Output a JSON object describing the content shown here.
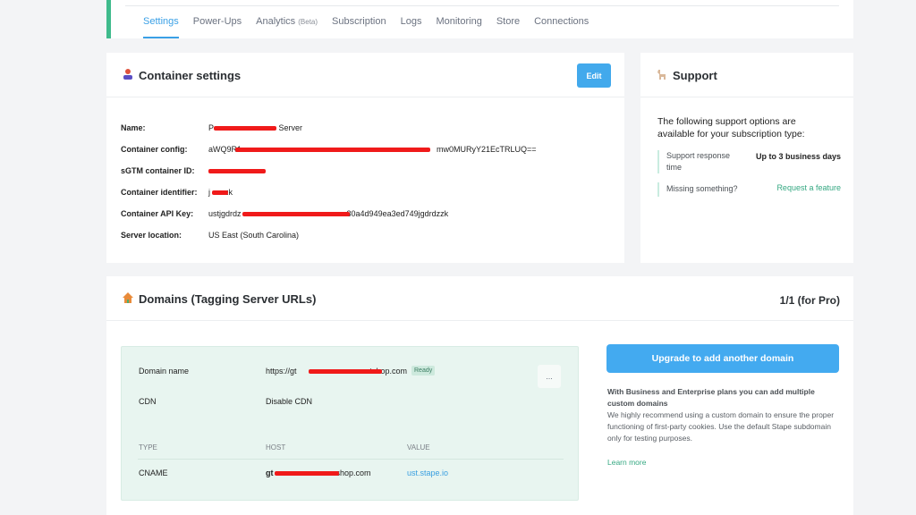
{
  "tabs": [
    {
      "label": "Settings",
      "active": true
    },
    {
      "label": "Power-Ups"
    },
    {
      "label": "Analytics",
      "badge": "(Beta)"
    },
    {
      "label": "Subscription"
    },
    {
      "label": "Logs"
    },
    {
      "label": "Monitoring"
    },
    {
      "label": "Store"
    },
    {
      "label": "Connections"
    }
  ],
  "container": {
    "title": "Container settings",
    "edit_label": "Edit",
    "rows": [
      {
        "label": "Name:",
        "value": "P",
        "suffix": " Server"
      },
      {
        "label": "Container config:",
        "value": "aWQ9R1",
        "suffix": "mw0MURyY21EcTRLUQ=="
      },
      {
        "label": "sGTM container ID:",
        "value": "",
        "suffix": ""
      },
      {
        "label": "Container identifier:",
        "value": "j",
        "suffix": "zk"
      },
      {
        "label": "Container API Key:",
        "value": "ustjgdrdz",
        "suffix": "30a4d949ea3ed749jgdrdzzk"
      },
      {
        "label": "Server location:",
        "value": "US East (South Carolina)",
        "suffix": ""
      }
    ]
  },
  "support": {
    "title": "Support",
    "description": "The following support options are available for your subscription type:",
    "response_label": "Support response time",
    "response_value": "Up to 3 business days",
    "missing_label": "Missing something?",
    "request_link": "Request a feature"
  },
  "domains": {
    "title": "Domains (Tagging Server URLs)",
    "count": "1/1 (for Pro)",
    "domain_name_label": "Domain name",
    "domain_name_prefix": "https://gt",
    "domain_name_suffix": "tshop.com",
    "status": "Ready",
    "more": "...",
    "cdn_label": "CDN",
    "cdn_value": "Disable CDN",
    "columns": [
      "TYPE",
      "HOST",
      "VALUE"
    ],
    "record": {
      "type": "CNAME",
      "host_prefix": "gt",
      "host_suffix": "shop.com",
      "value": "ust.stape.io"
    },
    "upgrade_button": "Upgrade to add another domain",
    "upgrade_note_bold": "With Business and Enterprise plans you can add multiple custom domains",
    "upgrade_note": "We highly recommend using a custom domain to ensure the proper functioning of first-party cookies. Use the default Stape subdomain only for testing purposes.",
    "learn_more": "Learn more"
  },
  "colors": {
    "accent": "#42a9ec",
    "green": "#35a882",
    "redaction": "#f01a1a"
  }
}
